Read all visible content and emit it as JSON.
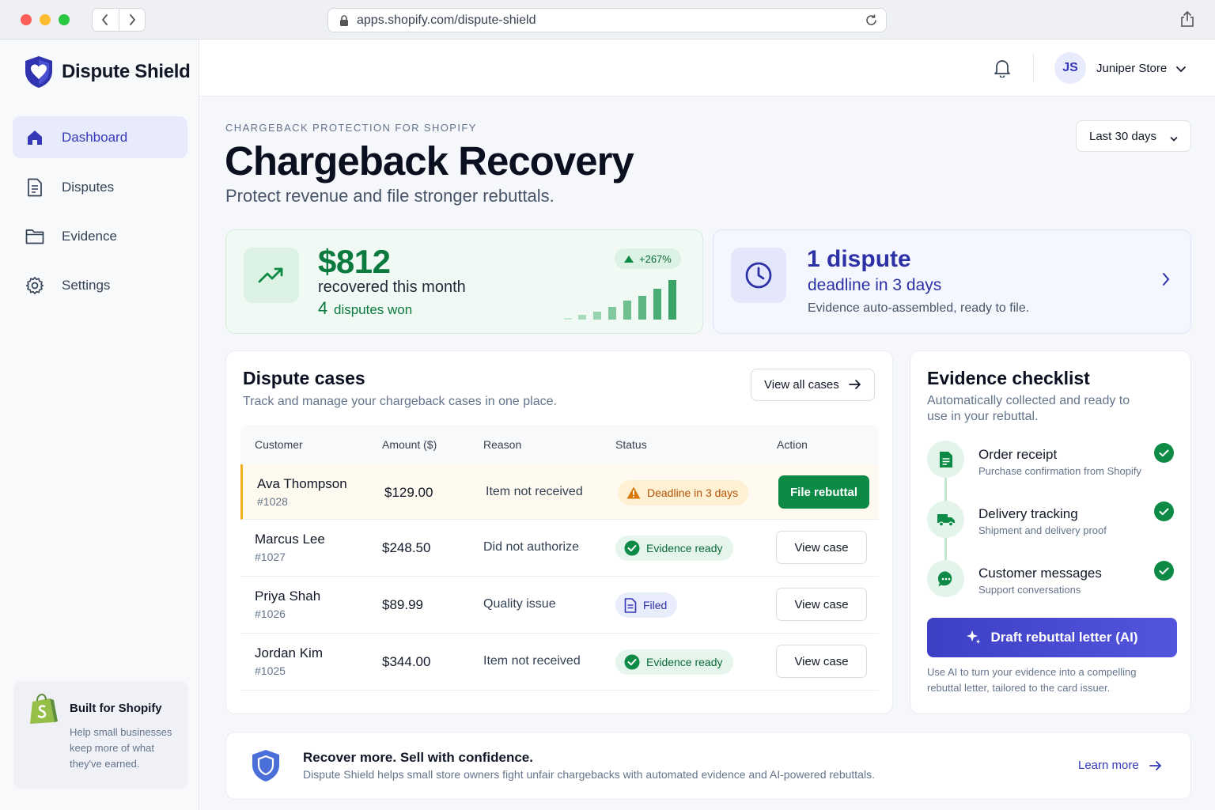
{
  "browser": {
    "url": "apps.shopify.com/dispute-shield"
  },
  "brand": {
    "name": "Dispute Shield",
    "accent": "#3538b8",
    "success": "#0c8a46"
  },
  "sidebar": {
    "items": [
      {
        "label": "Dashboard",
        "icon": "home-icon",
        "active": true
      },
      {
        "label": "Disputes",
        "icon": "document-icon",
        "active": false
      },
      {
        "label": "Evidence",
        "icon": "folder-icon",
        "active": false
      },
      {
        "label": "Settings",
        "icon": "gear-icon",
        "active": false
      }
    ],
    "promo": {
      "title": "Built for Shopify",
      "body": "Help small businesses keep more of what they've earned."
    }
  },
  "topbar": {
    "initials": "JS",
    "store": "Juniper Store"
  },
  "header": {
    "eyebrow": "CHARGEBACK PROTECTION FOR SHOPIFY",
    "title": "Chargeback Recovery",
    "subtitle": "Protect revenue and file stronger rebuttals.",
    "range": "Last 30 days"
  },
  "recovered": {
    "amount": "$812",
    "label": "recovered this month",
    "won_count": "4",
    "won_label": "disputes won",
    "change": "+267%"
  },
  "deadline": {
    "count": "1 dispute",
    "detail": "deadline in 3 days",
    "note": "Evidence auto-assembled, ready to file."
  },
  "cases": {
    "title": "Dispute cases",
    "subtitle": "Track and manage your chargeback cases in one place.",
    "view_all": "View all cases",
    "columns": [
      "Customer",
      "Amount ($)",
      "Reason",
      "Status",
      "Action"
    ],
    "rows": [
      {
        "customer": "Ava Thompson",
        "id": "#1028",
        "amount": "$129.00",
        "reason": "Item not received",
        "status": "Deadline in 3 days",
        "action": "File rebuttal"
      },
      {
        "customer": "Marcus Lee",
        "id": "#1027",
        "amount": "$248.50",
        "reason": "Did not authorize",
        "status": "Evidence ready",
        "action": "View case"
      },
      {
        "customer": "Priya Shah",
        "id": "#1026",
        "amount": "$89.99",
        "reason": "Quality issue",
        "status": "Filed",
        "action": "View case"
      },
      {
        "customer": "Jordan Kim",
        "id": "#1025",
        "amount": "$344.00",
        "reason": "Item not received",
        "status": "Evidence ready",
        "action": "View case"
      }
    ]
  },
  "checklist": {
    "title": "Evidence checklist",
    "subtitle": "Automatically collected and ready to use in your rebuttal.",
    "items": [
      {
        "title": "Order receipt",
        "desc": "Purchase confirmation from Shopify"
      },
      {
        "title": "Delivery tracking",
        "desc": "Shipment and delivery proof"
      },
      {
        "title": "Customer messages",
        "desc": "Support conversations"
      }
    ],
    "cta": "Draft rebuttal letter (AI)",
    "cta_note": "Use AI to turn your evidence into a compelling rebuttal letter, tailored to the card issuer."
  },
  "banner": {
    "title": "Recover more. Sell with confidence.",
    "desc": "Dispute Shield helps small store owners fight unfair chargebacks with automated evidence and AI-powered rebuttals.",
    "link": "Learn more"
  }
}
